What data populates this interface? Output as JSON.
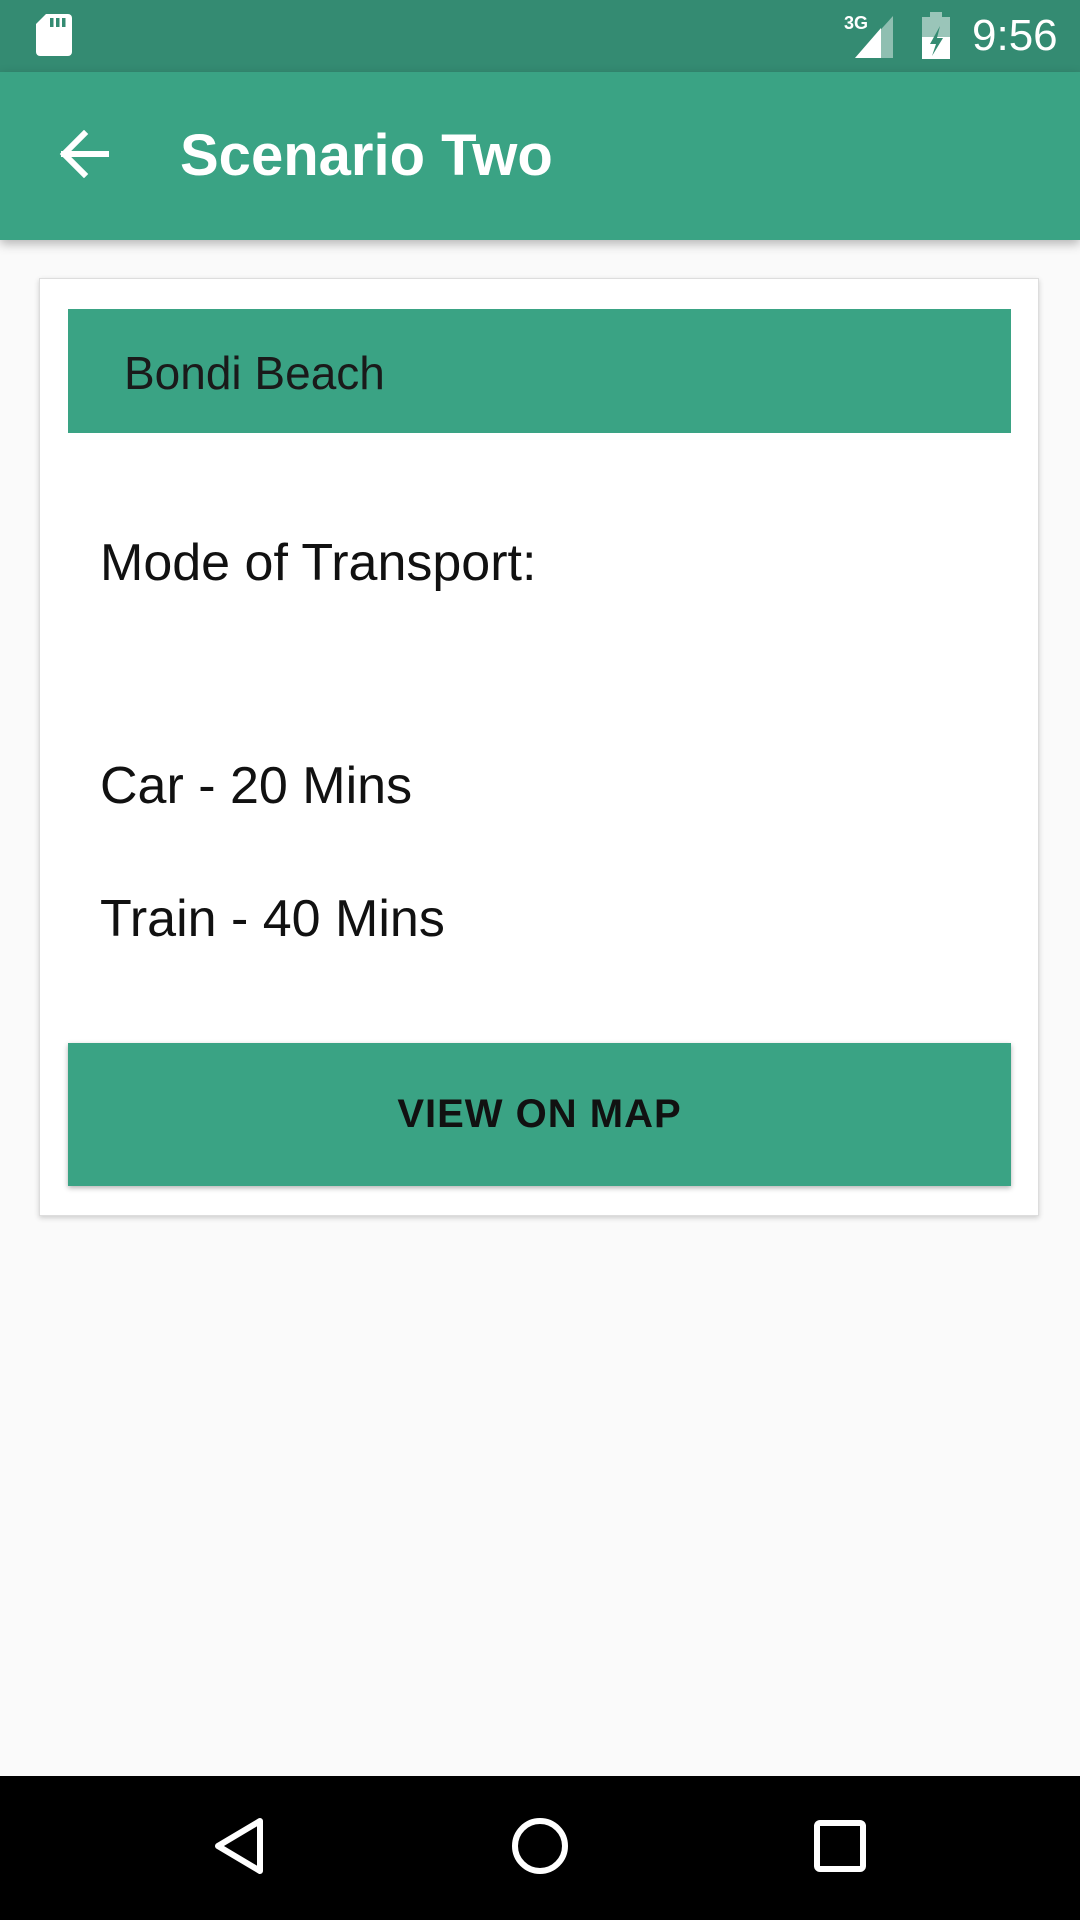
{
  "status_bar": {
    "network": "3G",
    "time": "9:56",
    "icons": [
      "sd-card-icon",
      "signal-icon",
      "battery-charging-icon"
    ]
  },
  "app_bar": {
    "title": "Scenario Two",
    "back_icon": "arrow-back-icon"
  },
  "card": {
    "place_name": "Bondi Beach",
    "transport_label": "Mode of Transport:",
    "transport_options": [
      "Car - 20 Mins",
      "Train - 40 Mins"
    ],
    "button_label": "VIEW ON MAP"
  },
  "nav_bar": {
    "icons": [
      "nav-back-icon",
      "nav-home-icon",
      "nav-recents-icon"
    ]
  },
  "colors": {
    "status_bar": "#348b72",
    "primary": "#3aa384",
    "background": "#fafafa",
    "nav_bar": "#000000"
  }
}
